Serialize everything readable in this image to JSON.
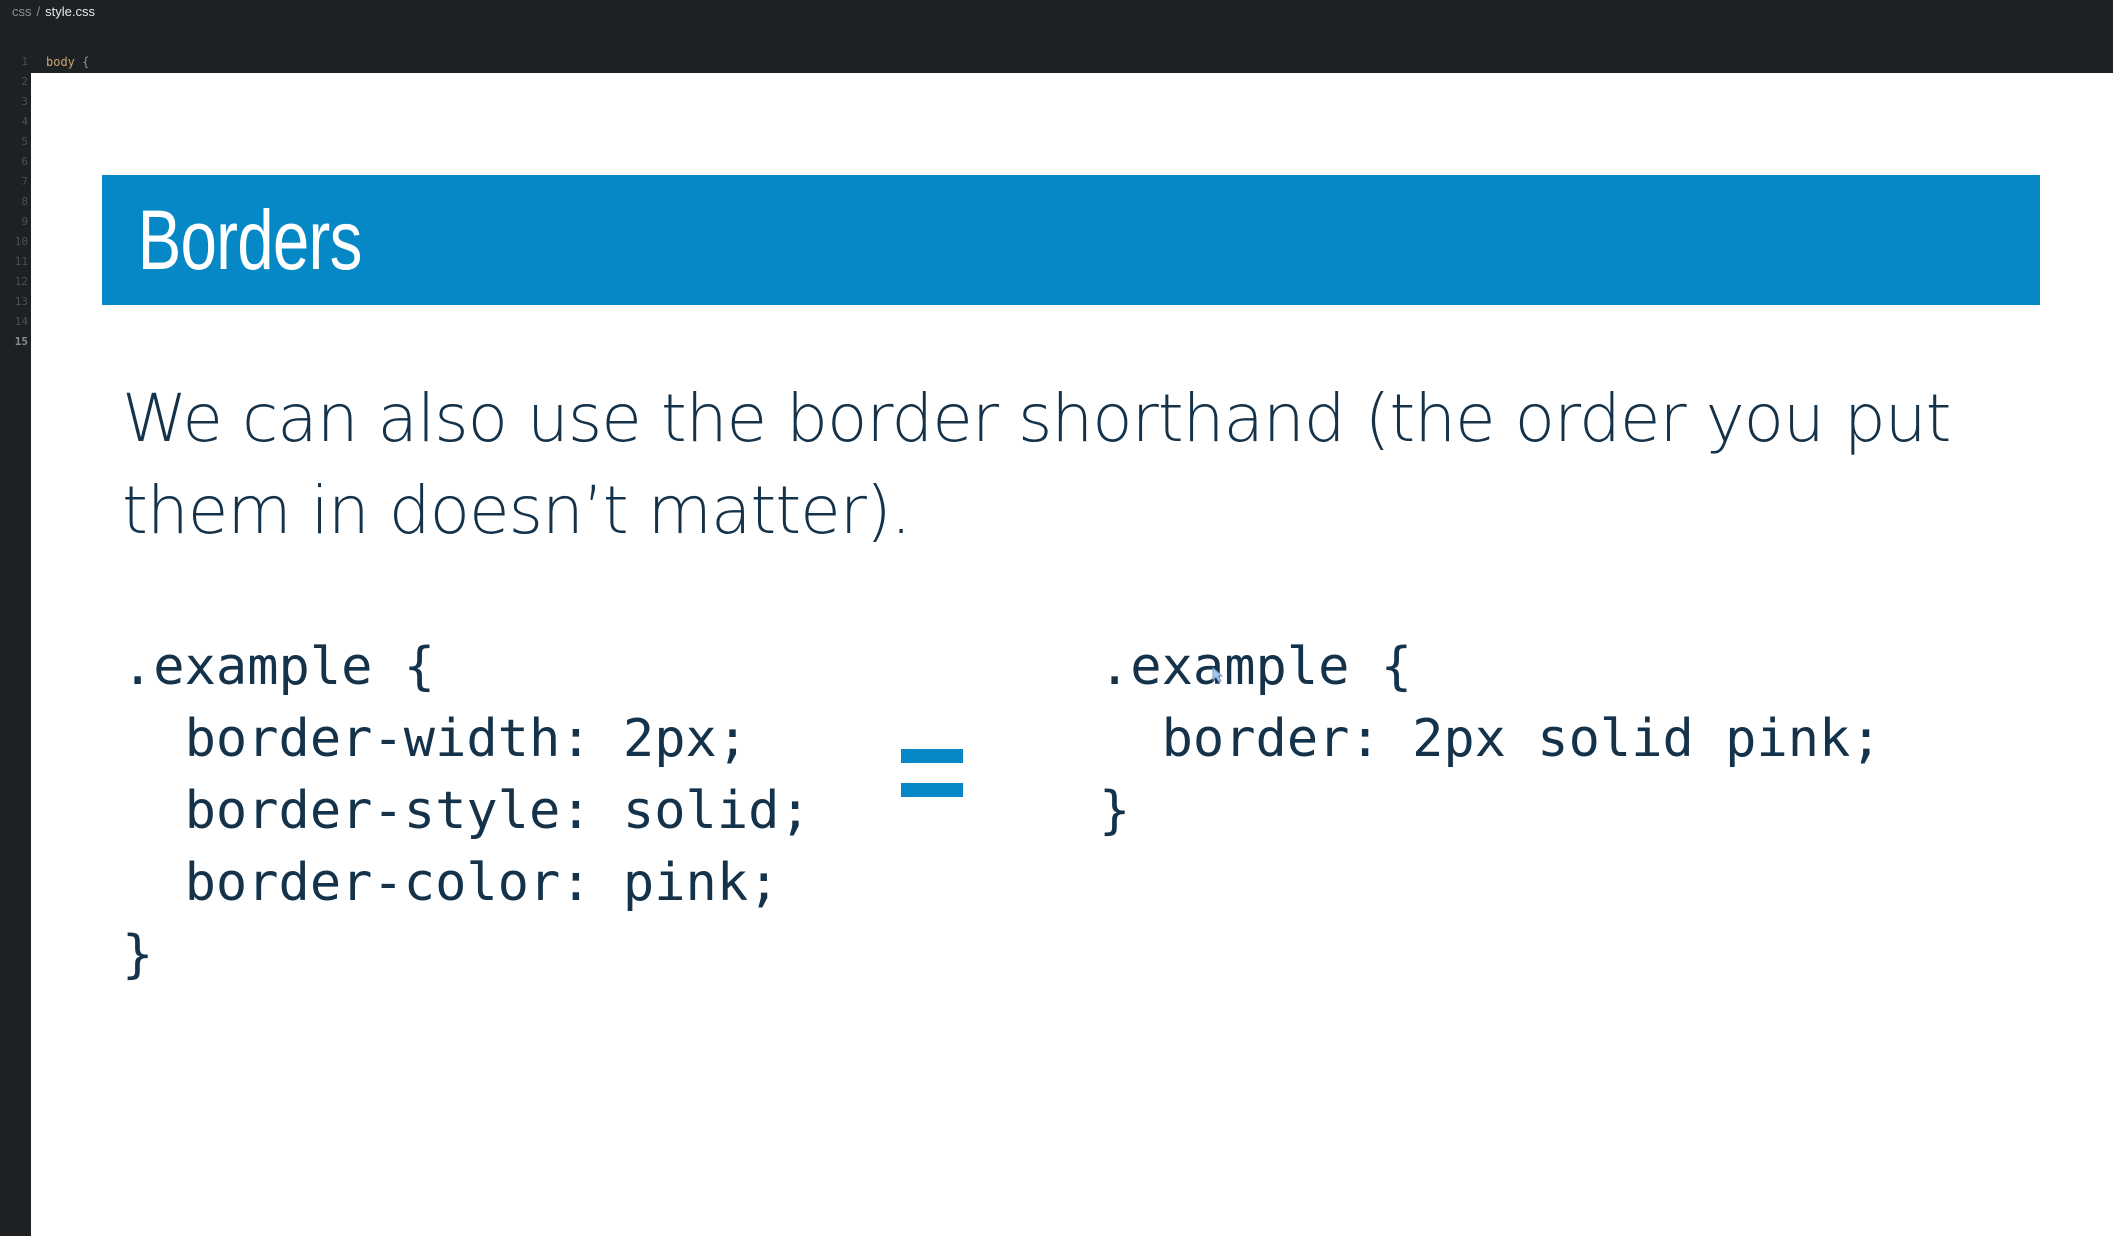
{
  "editor": {
    "breadcrumb": {
      "folder": "css",
      "separator": "/",
      "file": "style.css"
    },
    "line_numbers": [
      "1",
      "2",
      "3",
      "4",
      "5",
      "6",
      "7",
      "8",
      "9",
      "10",
      "11",
      "12",
      "13",
      "14",
      "15"
    ],
    "active_line": "15",
    "first_line_code": {
      "selector": "body",
      "brace": "{"
    }
  },
  "slide": {
    "title": "Borders",
    "body_text": "We can also use the border shorthand (the order you put them in doesn’t matter).",
    "code_left": {
      "line1": ".example {",
      "line2": "  border-width: 2px;",
      "line3": "  border-style: solid;",
      "line4": "  border-color: pink;",
      "line5": "}"
    },
    "equals_symbol": "=",
    "code_right": {
      "line1": ".example {",
      "line2": "  border: 2px solid pink;",
      "line3": "}"
    }
  },
  "colors": {
    "editor_bg": "#1e2124",
    "accent_blue": "#0588c5",
    "text_dark": "#14324a",
    "slide_bg": "#ffffff"
  }
}
